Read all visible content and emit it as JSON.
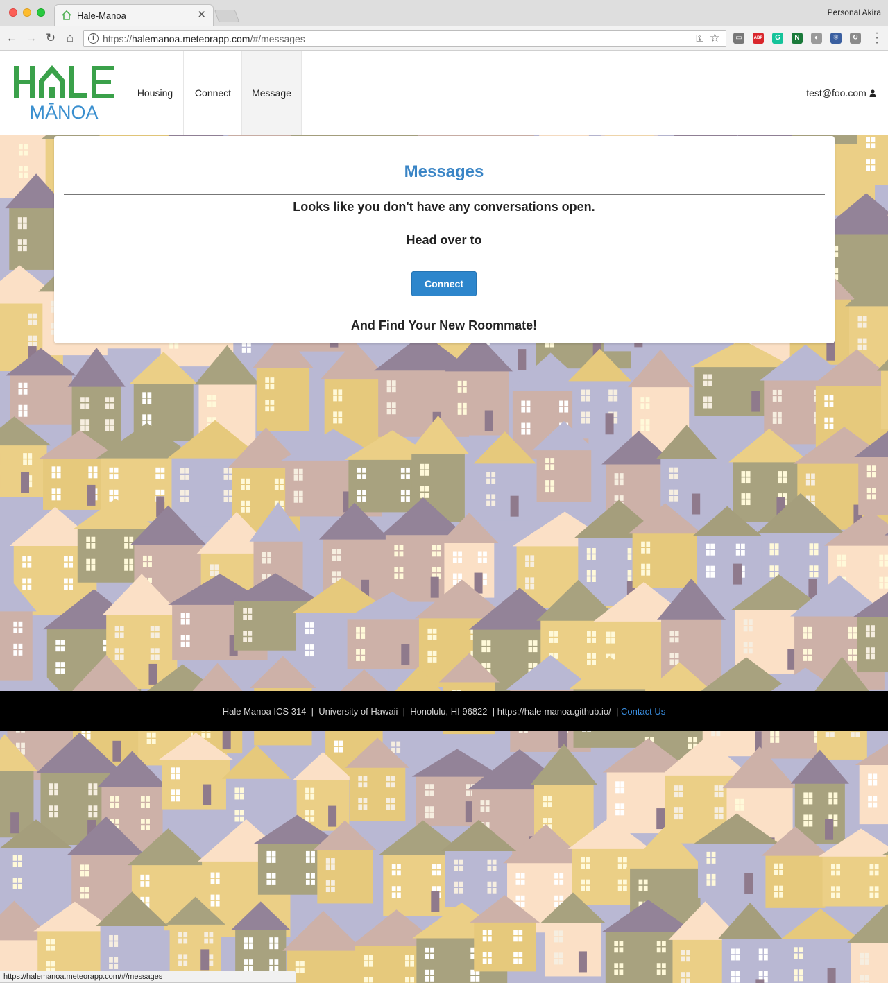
{
  "browser": {
    "tab_title": "Hale-Manoa",
    "tab_close": "✕",
    "profile": "Personal Akira",
    "url_prefix": "https://",
    "url_host": "halemanoa.meteorapp.com",
    "url_path": "/#/messages",
    "status_url": "https://halemanoa.meteorapp.com/#/messages",
    "extensions": [
      {
        "name": "cast-icon",
        "label": "▭",
        "color": "#777777"
      },
      {
        "name": "adblock-icon",
        "label": "ABP",
        "color": "#d9262c"
      },
      {
        "name": "grammarly-icon",
        "label": "G",
        "color": "#15c39a"
      },
      {
        "name": "n-extension-icon",
        "label": "N",
        "color": "#1a7a3a"
      },
      {
        "name": "palette-icon",
        "label": "◐",
        "color": "#9a9a9a"
      },
      {
        "name": "react-devtools-icon",
        "label": "⚛",
        "color": "#3a5fa0"
      },
      {
        "name": "refresh-extension-icon",
        "label": "↻",
        "color": "#8a8a8a"
      }
    ]
  },
  "site": {
    "logo_top": "HALE",
    "logo_bottom": "MĀNOA",
    "nav": [
      "Housing",
      "Connect",
      "Message"
    ],
    "user_email": "test@foo.com",
    "user_icon": "👤"
  },
  "messages": {
    "title": "Messages",
    "empty_line": "Looks like you don't have any conversations open.",
    "head_over": "Head over to",
    "connect_label": "Connect",
    "find_line": "And Find Your New Roommate!"
  },
  "footer": {
    "text": "Hale Manoa ICS 314  |  University of Hawaii  |  Honolulu, HI 96822  | https://hale-manoa.github.io/  | ",
    "contact": "Contact Us"
  },
  "colors": {
    "accent_blue": "#3a85c6",
    "logo_green": "#3aa14a",
    "logo_blue": "#3a8fcf"
  }
}
